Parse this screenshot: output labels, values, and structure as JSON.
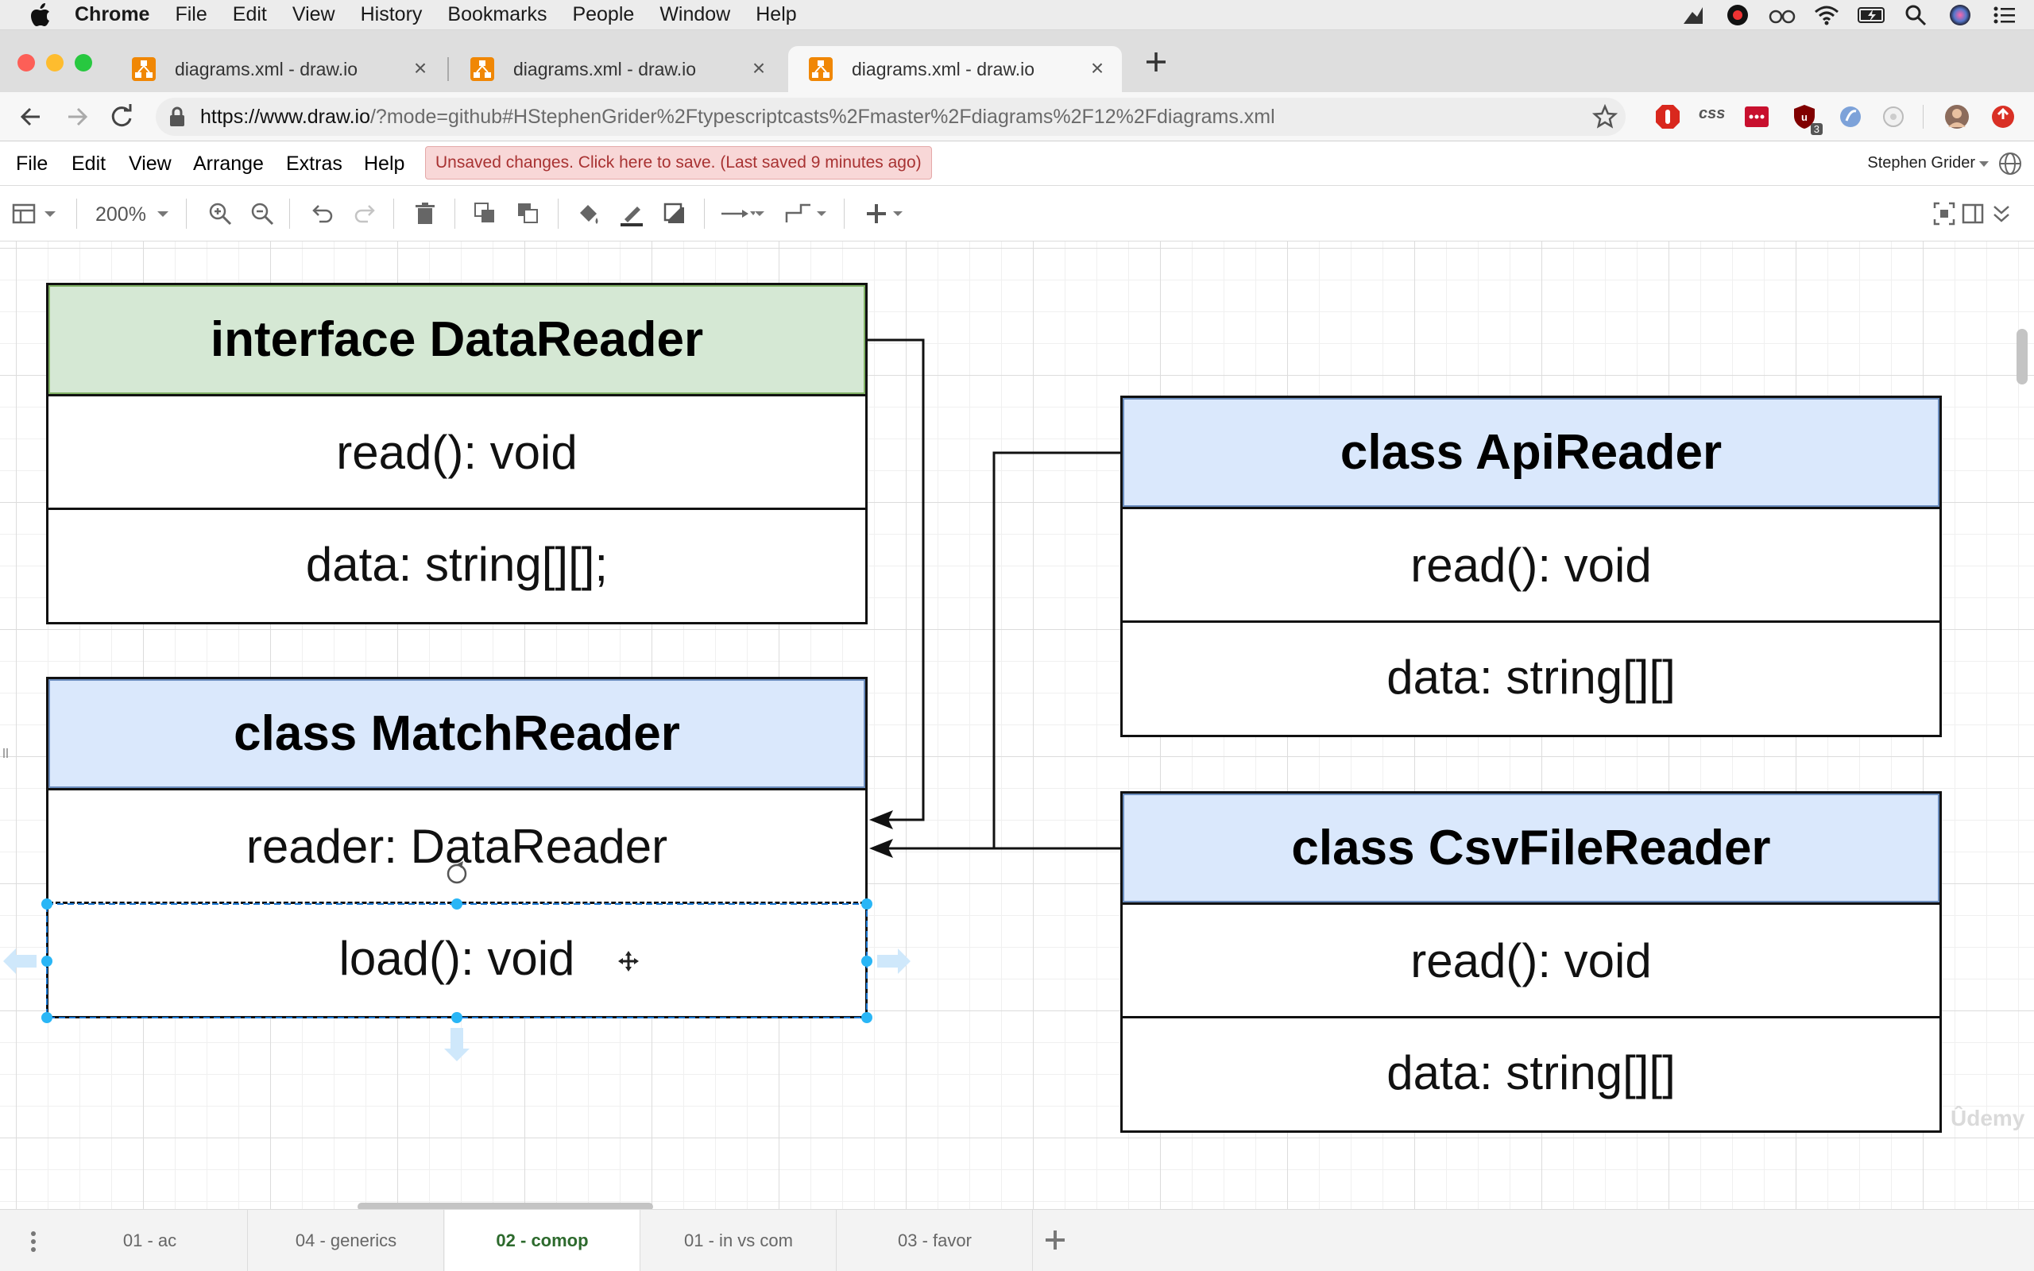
{
  "mac_menu": {
    "app": "Chrome",
    "items": [
      "File",
      "Edit",
      "View",
      "History",
      "Bookmarks",
      "People",
      "Window",
      "Help"
    ]
  },
  "browser": {
    "tabs": [
      {
        "title": "diagrams.xml - draw.io",
        "active": false
      },
      {
        "title": "diagrams.xml - draw.io",
        "active": false
      },
      {
        "title": "diagrams.xml - draw.io",
        "active": true
      }
    ],
    "url_prefix": "https://www.draw.io",
    "url_rest": "/?mode=github#HStephenGrider%2Ftypescriptcasts%2Fmaster%2Fdiagrams%2F12%2Fdiagrams.xml",
    "extension_badge": "3"
  },
  "drawio": {
    "menu": [
      "File",
      "Edit",
      "View",
      "Arrange",
      "Extras",
      "Help"
    ],
    "save_notice": "Unsaved changes. Click here to save. (Last saved 9 minutes ago)",
    "user": "Stephen Grider",
    "zoom": "200%"
  },
  "diagram": {
    "datareader": {
      "title": "interface DataReader",
      "rows": [
        "read(): void",
        "data: string[][];"
      ],
      "header_color": "#d5e8d4"
    },
    "matchreader": {
      "title": "class MatchReader",
      "rows": [
        "reader: DataReader",
        "load(): void"
      ],
      "header_color": "#dae8fc"
    },
    "apireader": {
      "title": "class ApiReader",
      "rows": [
        "read(): void",
        "data: string[][]"
      ],
      "header_color": "#dae8fc"
    },
    "csvreader": {
      "title": "class CsvFileReader",
      "rows": [
        "read(): void",
        "data: string[][]"
      ],
      "header_color": "#dae8fc"
    }
  },
  "watermark": "Ûdemy",
  "pages": [
    {
      "label": "01 - ac",
      "active": false
    },
    {
      "label": "04 - generics",
      "active": false
    },
    {
      "label": "02 - comop",
      "active": true
    },
    {
      "label": "01 - in vs com",
      "active": false
    },
    {
      "label": "03 - favor",
      "active": false
    }
  ]
}
